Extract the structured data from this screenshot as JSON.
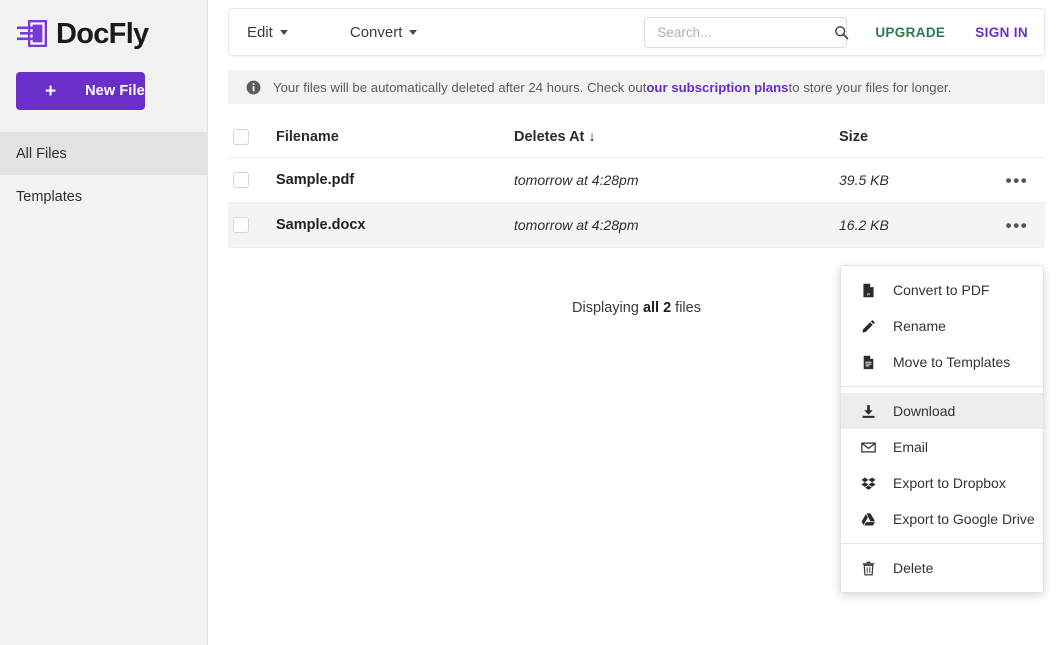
{
  "brand": {
    "name": "DocFly",
    "logo_icon": "docfly-logo-icon",
    "accent_purple": "#6a2fc9"
  },
  "sidebar": {
    "new_file_button": {
      "label": "New File",
      "plus": "+"
    },
    "items": [
      {
        "label": "All Files",
        "active": true
      },
      {
        "label": "Templates",
        "active": false
      }
    ]
  },
  "toolbar": {
    "menus": [
      {
        "label": "Edit"
      },
      {
        "label": "Convert"
      }
    ],
    "search": {
      "placeholder": "Search...",
      "value": "",
      "icon": "search-icon"
    },
    "upgrade_label": "UPGRADE",
    "upgrade_color": "#2d7a4e",
    "signin_label": "SIGN IN",
    "signin_color": "#6a2fc9"
  },
  "banner": {
    "icon": "info-icon",
    "text_before": "Your files will be automatically deleted after 24 hours. Check out ",
    "link_text": "our subscription plans",
    "text_after": " to store your files for longer."
  },
  "table": {
    "headers": {
      "filename": "Filename",
      "deletes_at": "Deletes At",
      "sort_arrow": "↓",
      "size": "Size"
    },
    "rows": [
      {
        "filename": "Sample.pdf",
        "deletes_at": "tomorrow at 4:28pm",
        "size": "39.5 KB",
        "checked": false,
        "shaded": false,
        "actions": "•••"
      },
      {
        "filename": "Sample.docx",
        "deletes_at": "tomorrow at 4:28pm",
        "size": "16.2 KB",
        "checked": false,
        "shaded": true,
        "actions": "•••"
      }
    ]
  },
  "footer": {
    "displaying_prefix": "Displaying ",
    "displaying_count": "all 2",
    "displaying_suffix": " files"
  },
  "context_menu": {
    "items": [
      {
        "label": "Convert to PDF",
        "icon": "pdf-file-icon",
        "hovered": false
      },
      {
        "label": "Rename",
        "icon": "pencil-icon",
        "hovered": false
      },
      {
        "label": "Move to Templates",
        "icon": "document-icon",
        "hovered": false
      },
      {
        "label": "Download",
        "icon": "download-icon",
        "hovered": true
      },
      {
        "label": "Email",
        "icon": "envelope-icon",
        "hovered": false
      },
      {
        "label": "Export to Dropbox",
        "icon": "dropbox-icon",
        "hovered": false
      },
      {
        "label": "Export to Google Drive",
        "icon": "google-drive-icon",
        "hovered": false
      },
      {
        "label": "Delete",
        "icon": "trash-icon",
        "hovered": false
      }
    ]
  }
}
